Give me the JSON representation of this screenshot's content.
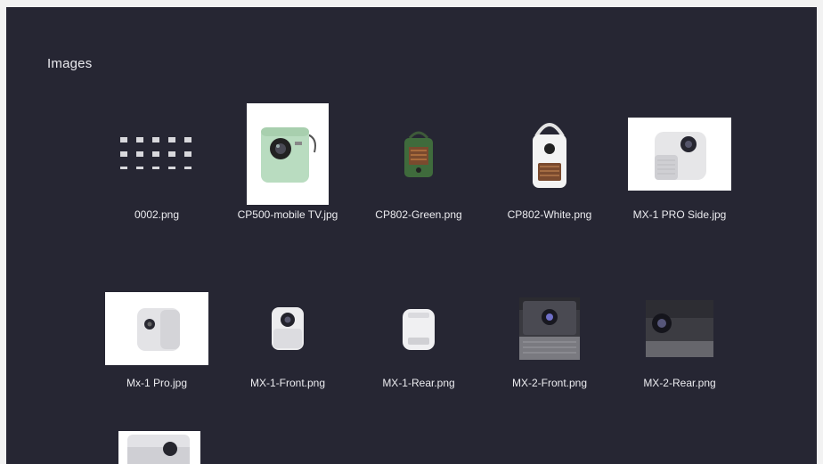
{
  "section_title": "Images",
  "files": [
    {
      "name": "0002.png",
      "icon": "pattern-thumbnail-icon"
    },
    {
      "name": "CP500-mobile TV.jpg",
      "icon": "green-projector-thumbnail"
    },
    {
      "name": "CP802-Green.png",
      "icon": "green-radio-projector-thumbnail"
    },
    {
      "name": "CP802-White.png",
      "icon": "white-radio-projector-thumbnail"
    },
    {
      "name": "MX-1 PRO Side.jpg",
      "icon": "white-projector-side-thumbnail"
    },
    {
      "name": "Mx-1 Pro.jpg",
      "icon": "white-projector-thumbnail"
    },
    {
      "name": "MX-1-Front.png",
      "icon": "projector-front-thumbnail"
    },
    {
      "name": "MX-1-Rear.png",
      "icon": "projector-rear-thumbnail"
    },
    {
      "name": "MX-2-Front.png",
      "icon": "dark-projector-front-thumbnail"
    },
    {
      "name": "MX-2-Rear.png",
      "icon": "dark-projector-rear-thumbnail"
    }
  ],
  "colors": {
    "background": "#262633",
    "text": "#ececf0"
  }
}
